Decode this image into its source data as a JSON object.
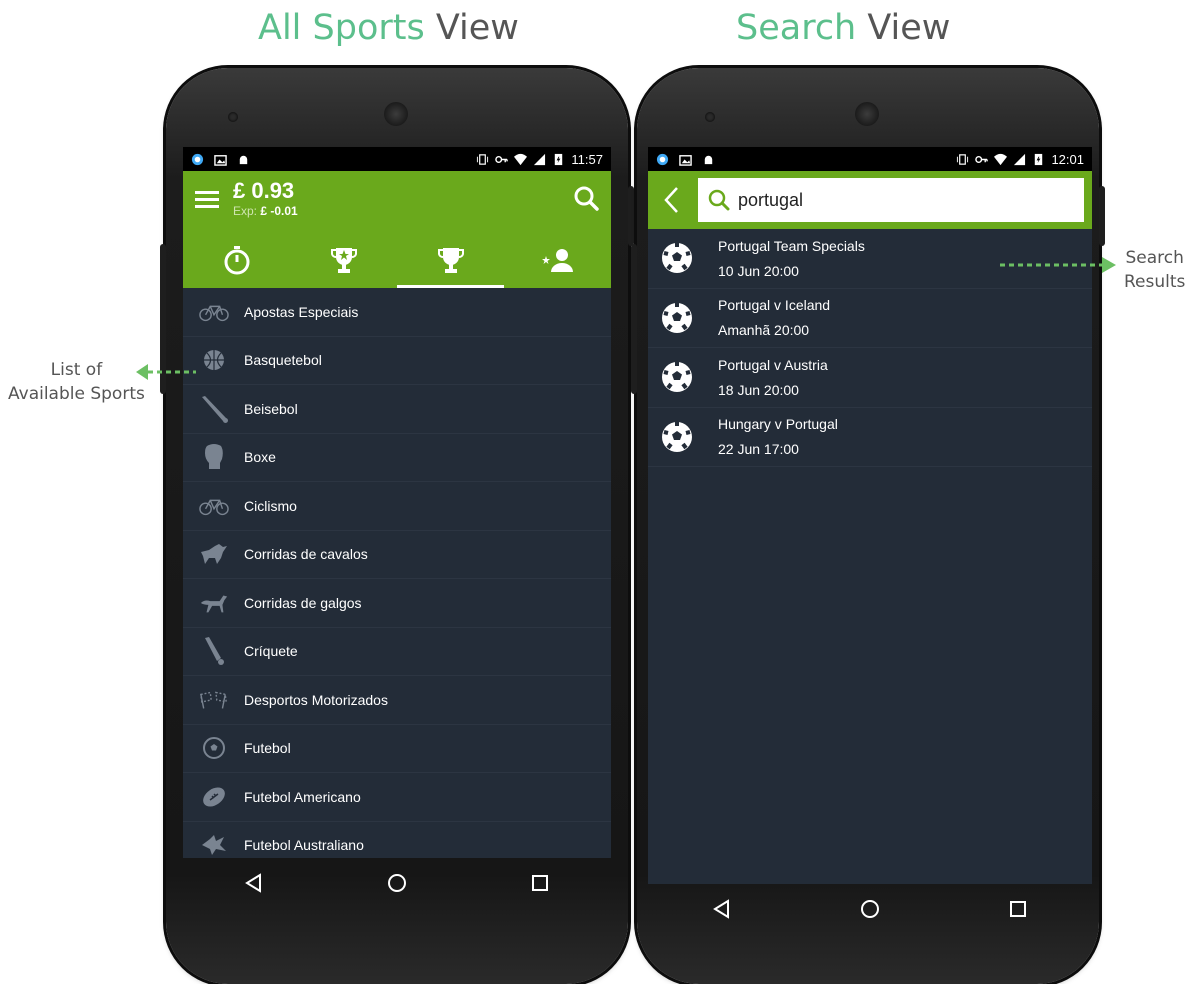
{
  "headings": {
    "left": {
      "highlight": "All Sports",
      "rest": " View"
    },
    "right": {
      "highlight": "Search",
      "rest": " View"
    }
  },
  "callouts": {
    "left_line1": "List of",
    "left_line2": "Available Sports",
    "right_line1": "Search",
    "right_line2": "Results"
  },
  "left_phone": {
    "status_time": "11:57",
    "balance": "£ 0.93",
    "exp_label": "Exp:",
    "exp_value": "£ -0.01",
    "tab_icons": [
      "stopwatch-icon",
      "trophy-star-icon",
      "trophy-icon",
      "favorite-person-icon"
    ],
    "active_tab": 2,
    "sports": [
      {
        "label": "Apostas Especiais",
        "icon": "bicycle-icon"
      },
      {
        "label": "Basquetebol",
        "icon": "basketball-icon"
      },
      {
        "label": "Beisebol",
        "icon": "baseball-bat-icon"
      },
      {
        "label": "Boxe",
        "icon": "boxing-glove-icon"
      },
      {
        "label": "Ciclismo",
        "icon": "bicycle-icon"
      },
      {
        "label": "Corridas de cavalos",
        "icon": "horse-racing-icon"
      },
      {
        "label": "Corridas de galgos",
        "icon": "greyhound-icon"
      },
      {
        "label": "Críquete",
        "icon": "cricket-icon"
      },
      {
        "label": "Desportos Motorizados",
        "icon": "checkered-flags-icon"
      },
      {
        "label": "Futebol",
        "icon": "soccer-ball-icon"
      },
      {
        "label": "Futebol Americano",
        "icon": "american-football-icon"
      },
      {
        "label": "Futebol Australiano",
        "icon": "australian-football-icon"
      }
    ]
  },
  "right_phone": {
    "status_time": "12:01",
    "search_value": "portugal",
    "results": [
      {
        "name": "Portugal Team Specials",
        "time": "10 Jun 20:00"
      },
      {
        "name": "Portugal v Iceland",
        "time": "Amanhã 20:00"
      },
      {
        "name": "Portugal v Austria",
        "time": "18 Jun 20:00"
      },
      {
        "name": "Hungary v Portugal",
        "time": "22 Jun 17:00"
      }
    ]
  },
  "colors": {
    "accent_green": "#6aa91c",
    "list_bg": "#232c38",
    "heading_highlight": "#5cbf8c"
  }
}
